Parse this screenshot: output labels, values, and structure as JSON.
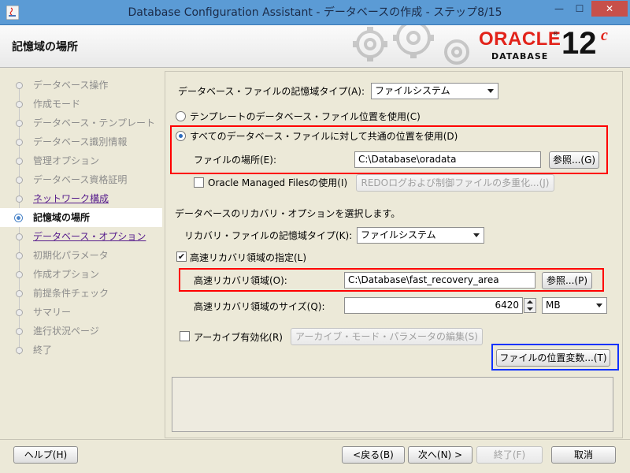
{
  "window": {
    "title": "Database Configuration Assistant - データベースの作成 - ステップ8/15",
    "minimize": "—",
    "maximize": "☐",
    "close": "✕"
  },
  "header": {
    "page_title": "記憶域の場所",
    "logo": {
      "word": "ORACLE",
      "tm": "®",
      "sub": "DATABASE",
      "version": "12",
      "version_suffix": "c"
    }
  },
  "nav": {
    "items": [
      {
        "label": "データベース操作",
        "state": "disabled"
      },
      {
        "label": "作成モード",
        "state": "disabled"
      },
      {
        "label": "データベース・テンプレート",
        "state": "disabled"
      },
      {
        "label": "データベース識別情報",
        "state": "disabled"
      },
      {
        "label": "管理オプション",
        "state": "disabled"
      },
      {
        "label": "データベース資格証明",
        "state": "disabled"
      },
      {
        "label": "ネットワーク構成",
        "state": "link"
      },
      {
        "label": "記憶域の場所",
        "state": "current"
      },
      {
        "label": "データベース・オプション",
        "state": "link"
      },
      {
        "label": "初期化パラメータ",
        "state": "disabled"
      },
      {
        "label": "作成オプション",
        "state": "disabled"
      },
      {
        "label": "前提条件チェック",
        "state": "disabled"
      },
      {
        "label": "サマリー",
        "state": "disabled"
      },
      {
        "label": "進行状況ページ",
        "state": "disabled"
      },
      {
        "label": "終了",
        "state": "disabled"
      }
    ]
  },
  "storage": {
    "type_label": "データベース・ファイルの記憶域タイプ(A):",
    "type_value": "ファイルシステム",
    "radio_template_label": "テンプレートのデータベース・ファイル位置を使用(C)",
    "radio_common_label": "すべてのデータベース・ファイルに対して共通の位置を使用(D)",
    "file_location_label": "ファイルの場所(E):",
    "file_location_value": "C:\\Database\\oradata",
    "browse_label": "参照...(G)",
    "omf_label": "Oracle Managed Filesの使用(I)",
    "multiplex_label": "REDOログおよび制御ファイルの多重化...(J)"
  },
  "recovery": {
    "intro": "データベースのリカバリ・オプションを選択します。",
    "type_label": "リカバリ・ファイルの記憶域タイプ(K):",
    "type_value": "ファイルシステム",
    "fra_check_label": "高速リカバリ領域の指定(L)",
    "fra_label": "高速リカバリ領域(O):",
    "fra_value": "C:\\Database\\fast_recovery_area",
    "fra_browse_label": "参照...(P)",
    "fra_size_label": "高速リカバリ領域のサイズ(Q):",
    "fra_size_value": "6420",
    "fra_unit": "MB",
    "archive_label": "アーカイブ有効化(R)",
    "archive_params_label": "アーカイブ・モード・パラメータの編集(S)",
    "file_vars_label": "ファイルの位置変数...(T)"
  },
  "footer": {
    "help": "ヘルプ(H)",
    "back": "<戻る(B)",
    "next": "次へ(N) >",
    "finish": "終了(F)",
    "cancel": "取消"
  }
}
